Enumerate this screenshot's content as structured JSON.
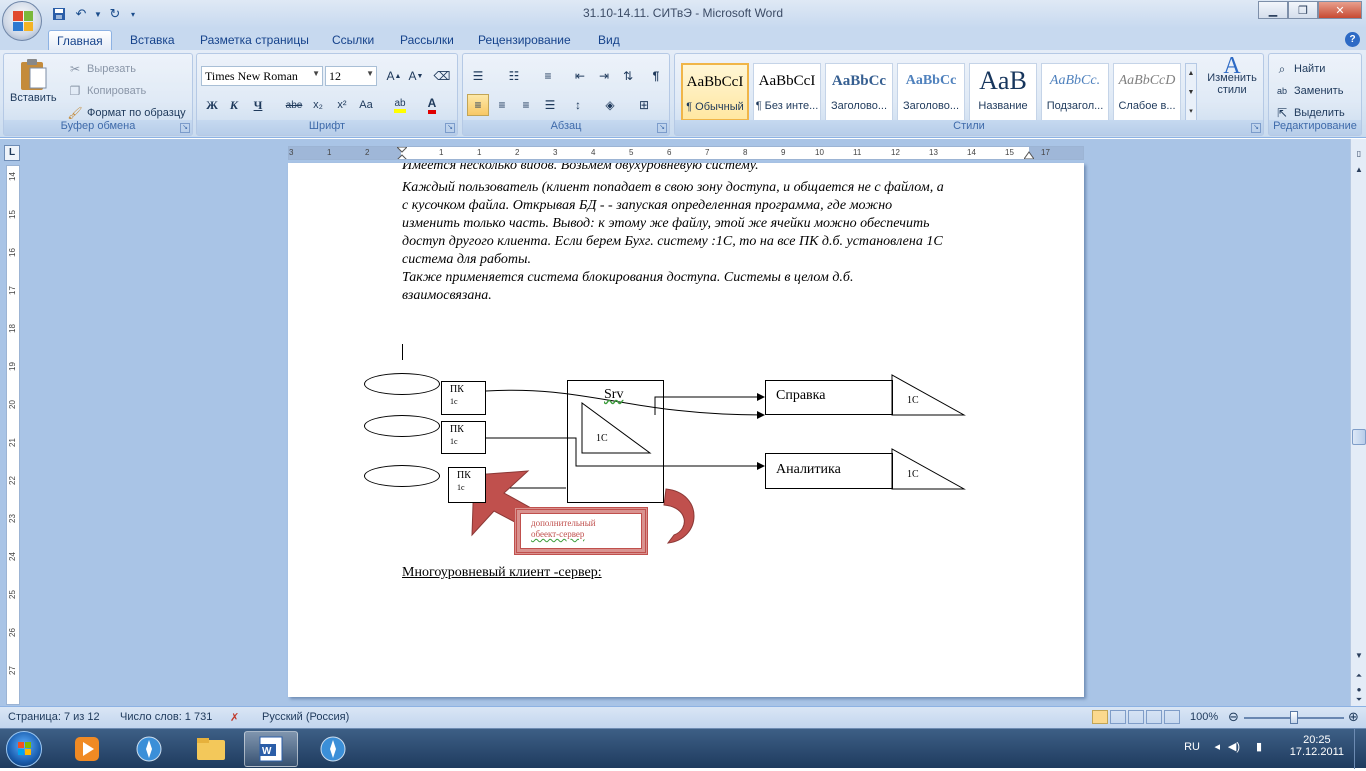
{
  "window": {
    "title": "31.10-14.11. СИТвЭ - Microsoft Word"
  },
  "tabs": [
    "Главная",
    "Вставка",
    "Разметка страницы",
    "Ссылки",
    "Рассылки",
    "Рецензирование",
    "Вид"
  ],
  "active_tab": "Главная",
  "ribbon": {
    "clipboard": {
      "label": "Буфер обмена",
      "paste": "Вставить",
      "cut": "Вырезать",
      "copy": "Копировать",
      "format_painter": "Формат по образцу"
    },
    "font": {
      "label": "Шрифт",
      "font_name": "Times New Roman",
      "font_size": "12",
      "bold": "Ж",
      "italic": "К",
      "underline": "Ч",
      "strike": "abe",
      "subscript": "x₂",
      "superscript": "x²",
      "change_case": "Aa"
    },
    "paragraph": {
      "label": "Абзац"
    },
    "styles": {
      "label": "Стили",
      "items": [
        {
          "preview": "AaBbCcI",
          "name": "¶ Обычный"
        },
        {
          "preview": "AaBbCcI",
          "name": "¶ Без инте..."
        },
        {
          "preview": "AaBbCc",
          "name": "Заголово..."
        },
        {
          "preview": "AaBbCc",
          "name": "Заголово..."
        },
        {
          "preview": "AaB",
          "name": "Название"
        },
        {
          "preview": "AaBbCc.",
          "name": "Подзагол..."
        },
        {
          "preview": "AaBbCcD",
          "name": "Слабое в..."
        }
      ],
      "change_styles": "Изменить стили"
    },
    "editing": {
      "label": "Редактирование",
      "find": "Найти",
      "replace": "Заменить",
      "select": "Выделить"
    }
  },
  "ruler": {
    "h_ticks": [
      "3",
      "1",
      "2",
      "1",
      "1",
      "2",
      "3",
      "4",
      "5",
      "6",
      "7",
      "8",
      "9",
      "10",
      "11",
      "12",
      "13",
      "14",
      "15",
      "16",
      "17"
    ],
    "v_ticks": [
      "14",
      "15",
      "16",
      "17",
      "18",
      "19",
      "20",
      "21",
      "22",
      "23",
      "24",
      "25",
      "26",
      "27"
    ]
  },
  "document": {
    "lines": [
      "Имеется несколько видов. Возьмем двухуровневую систему.",
      "Каждый пользователь (клиент попадает в свою зону доступа, и общается не с файлом, а",
      "с кусочком файла.  Открывая БД - - запуская определенная программа, где можно",
      "изменить только часть. Вывод: к этому же файлу, этой же ячейки можно обеспечить",
      "доступ другого клиента. Если берем Бухг. систему :1С, то на все ПК д.б. установлена 1С",
      "система для работы.",
      "Также применяется система блокирования доступа. Системы в целом д.б.",
      "взаимосвязана."
    ],
    "diagram": {
      "pk_label": "ПК",
      "pk_sub": "1с",
      "server_label": "Srv",
      "server_inner": "1С",
      "box1": "Справка",
      "box1_tri": "1С",
      "box2": "Аналитика",
      "box2_tri": "1С",
      "callout_line1": "дополнительный",
      "callout_line2": "обеект-сервер"
    },
    "caption": "Многоуровневый клиент -сервер:"
  },
  "status": {
    "page": "Страница: 7 из 12",
    "words": "Число слов: 1 731",
    "language": "Русский (Россия)",
    "zoom": "100%"
  },
  "taskbar": {
    "lang": "RU",
    "time": "20:25",
    "date": "17.12.2011"
  }
}
